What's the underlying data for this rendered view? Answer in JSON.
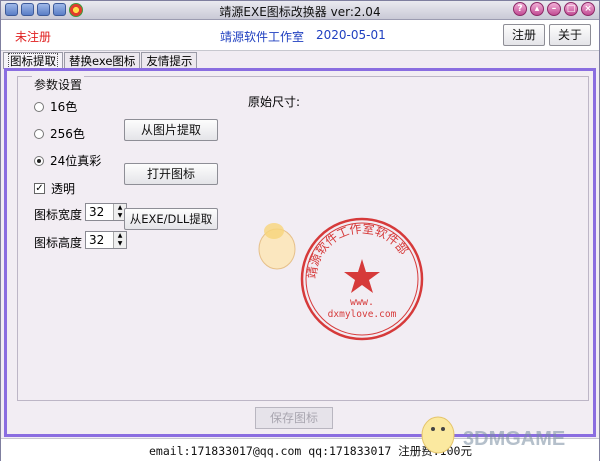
{
  "window": {
    "title": "靖源EXE图标改换器 ver:2.04"
  },
  "header": {
    "status": "未注册",
    "studio": "靖源软件工作室",
    "date": "2020-05-01",
    "register_label": "注册",
    "about_label": "关于"
  },
  "tabs": [
    {
      "label": "图标提取",
      "active": true
    },
    {
      "label": "替换exe图标",
      "active": false
    },
    {
      "label": "友情提示",
      "active": false
    }
  ],
  "params": {
    "group_title": "参数设置",
    "radios": [
      {
        "label": "16色",
        "checked": false
      },
      {
        "label": "256色",
        "checked": false
      },
      {
        "label": "24位真彩",
        "checked": true
      }
    ],
    "transparent_label": "透明",
    "transparent_checked": true,
    "width_label": "图标宽度",
    "width_value": "32",
    "height_label": "图标高度",
    "height_value": "32"
  },
  "actions": {
    "from_image": "从图片提取",
    "open_icon": "打开图标",
    "from_exe": "从EXE/DLL提取",
    "save_icon": "保存图标"
  },
  "preview": {
    "original_size_label": "原始尺寸:"
  },
  "stamp": {
    "ring_text": "靖源软件工作室软件部",
    "line1": "www.",
    "line2": "dxmylove.com",
    "color": "#d63a3a"
  },
  "footer": {
    "text": "email:171833017@qq.com  qq:171833017  注册费:100元"
  },
  "watermark": {
    "text": "3DMGAME"
  }
}
